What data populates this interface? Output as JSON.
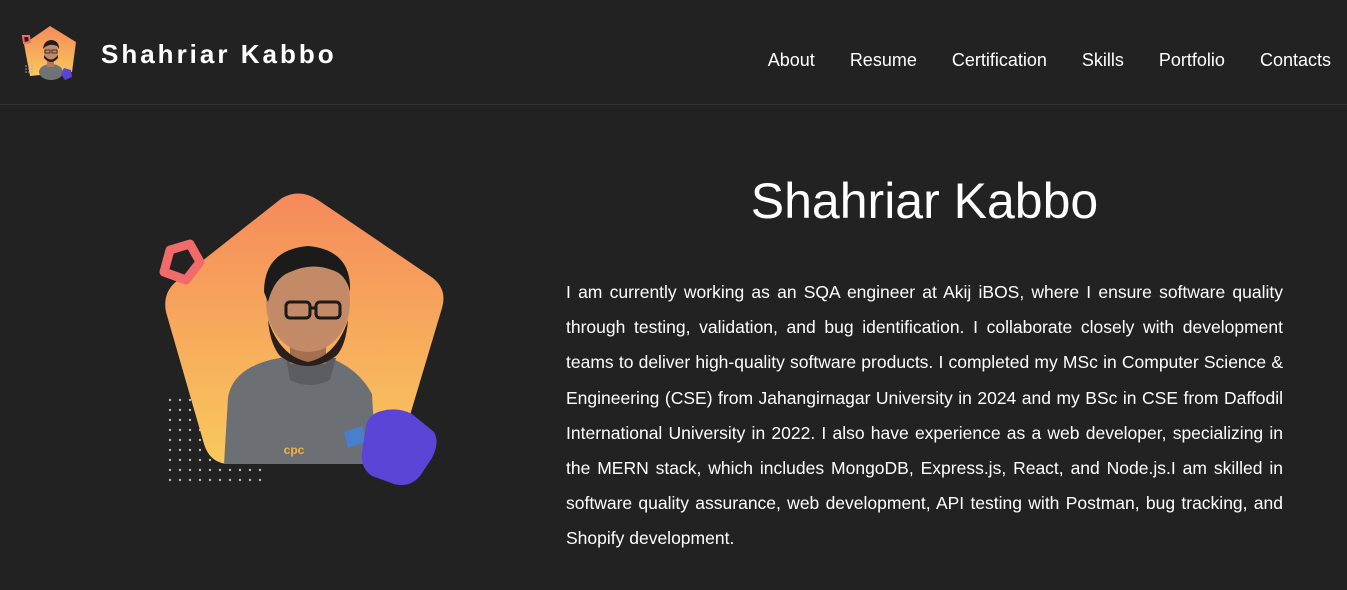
{
  "header": {
    "brand_name": "Shahriar Kabbo",
    "nav": [
      {
        "label": "About"
      },
      {
        "label": "Resume"
      },
      {
        "label": "Certification"
      },
      {
        "label": "Skills"
      },
      {
        "label": "Portfolio"
      },
      {
        "label": "Contacts"
      }
    ]
  },
  "hero": {
    "title": "Shahriar Kabbo",
    "bio": "I am currently working as an SQA engineer at Akij iBOS, where I ensure software quality through testing, validation, and bug identification. I collaborate closely with development teams to deliver high-quality software products. I completed my MSc in Computer Science & Engineering (CSE) from Jahangirnagar University in 2024 and my BSc in CSE from Daffodil International University in 2022. I also have experience as a web developer, specializing in the MERN stack, which includes MongoDB, Express.js, React, and Node.js.I am skilled in software quality assurance, web development, API testing with Postman, bug tracking, and Shopify development.",
    "shirt_logo_text": "cpc"
  },
  "colors": {
    "background": "#222223",
    "gradient_top": "#f48a5b",
    "gradient_bottom": "#f9c95c",
    "accent_blue": "#5a45d6",
    "accent_coral": "#f26b6b"
  }
}
